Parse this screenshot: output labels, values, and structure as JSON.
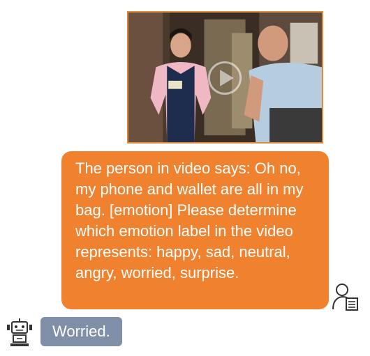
{
  "messages": {
    "user_text": "The person in video says: Oh no, my phone and wallet are all in my bag. [emotion] Please determine which emotion label in the video represents: happy, sad, neutral, angry, worried, surprise.",
    "bot_text": "Worried."
  },
  "colors": {
    "user_bubble": "#f0822f",
    "bot_bubble": "#7f8fa8",
    "video_border": "#e08a3c"
  },
  "icons": {
    "video_overlay": "play-icon",
    "user_avatar": "user-document-icon",
    "bot_avatar": "robot-icon"
  }
}
